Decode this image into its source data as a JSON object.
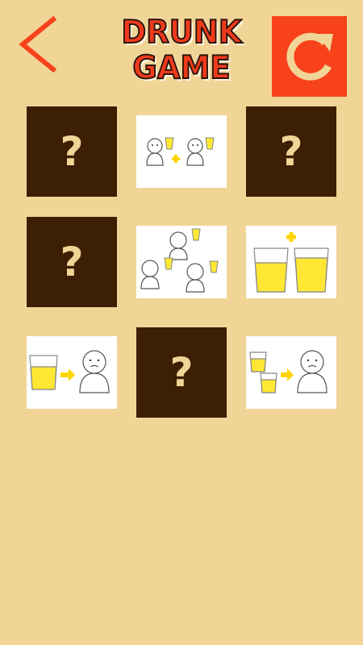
{
  "header": {
    "logo_line1": "DRUNK",
    "logo_line2": "GAME",
    "back_icon": "chevron-left-icon",
    "restart_icon": "restart-icon"
  },
  "colors": {
    "background": "#f1d597",
    "card_back": "#3d1f04",
    "question_mark": "#f1d597",
    "accent": "#f7421b",
    "logo_red": "#ef3a1c",
    "drink_yellow": "#ffe733"
  },
  "cards": [
    {
      "row": 1,
      "col": 1,
      "state": "hidden",
      "symbol": "?"
    },
    {
      "row": 1,
      "col": 2,
      "state": "revealed",
      "image": "two-people-with-drinks"
    },
    {
      "row": 1,
      "col": 3,
      "state": "hidden",
      "symbol": "?"
    },
    {
      "row": 2,
      "col": 1,
      "state": "hidden",
      "symbol": "?"
    },
    {
      "row": 2,
      "col": 2,
      "state": "revealed",
      "image": "three-people-with-drinks"
    },
    {
      "row": 2,
      "col": 3,
      "state": "revealed",
      "image": "two-glasses-plus"
    },
    {
      "row": 3,
      "col": 1,
      "state": "revealed",
      "image": "glass-to-person"
    },
    {
      "row": 3,
      "col": 2,
      "state": "hidden",
      "symbol": "?"
    },
    {
      "row": 3,
      "col": 3,
      "state": "revealed",
      "image": "two-glasses-to-person"
    }
  ]
}
